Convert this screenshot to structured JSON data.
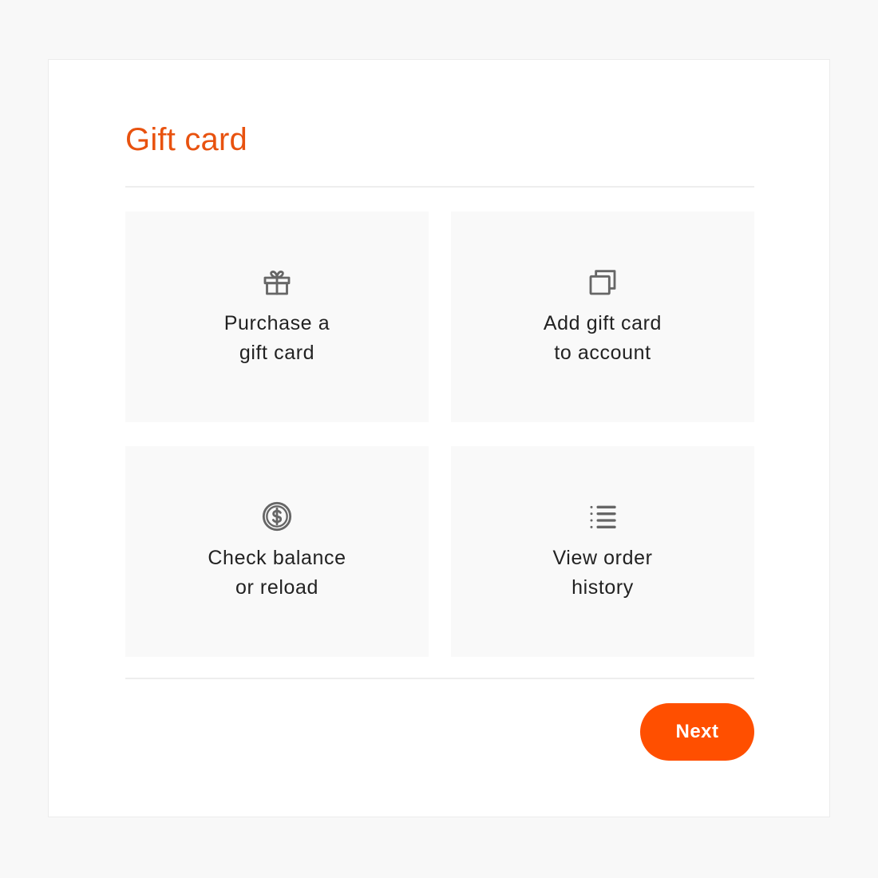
{
  "page": {
    "title": "Gift card",
    "accent_color": "#e8520f",
    "button_color": "#ff4f00"
  },
  "options": [
    {
      "label": "Purchase a\ngift card",
      "icon": "gift-icon"
    },
    {
      "label": "Add gift card\nto account",
      "icon": "cards-stack-icon"
    },
    {
      "label": "Check balance\nor reload",
      "icon": "dollar-circle-icon"
    },
    {
      "label": "View order\nhistory",
      "icon": "list-icon"
    }
  ],
  "footer": {
    "next_label": "Next"
  }
}
